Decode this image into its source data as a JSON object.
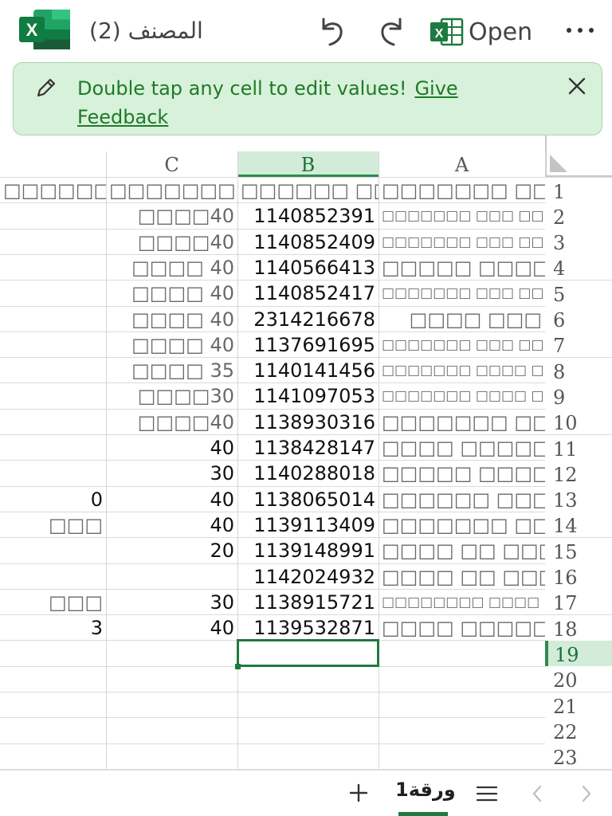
{
  "app": {
    "title": "المصنف (2)",
    "open_label": "Open",
    "logo_letter": "X"
  },
  "banner": {
    "message": "Double tap any cell to edit values!",
    "link": "Give Feedback"
  },
  "columns": [
    "C",
    "B",
    "A"
  ],
  "selected_column": "B",
  "rows": [
    {
      "n": "1",
      "a": "□□□□□□□ □□□",
      "b": "□□□□□□ □□□□□",
      "c": "□□□□□□□",
      "d": "□□□□□□□"
    },
    {
      "n": "2",
      "a": "□□□□□□□ □□□ □□ □□□□",
      "b": "1140852391",
      "c": "□□□□40",
      "d": ""
    },
    {
      "n": "3",
      "a": "□□□□□□□ □□□ □□ □□□□",
      "b": "1140852409",
      "c": "□□□□40",
      "d": ""
    },
    {
      "n": "4",
      "a": "□□□□□ □□□□□",
      "b": "1140566413",
      "c": "□□□□ 40",
      "d": ""
    },
    {
      "n": "5",
      "a": "□□□□□□□ □□□ □□ □□□□",
      "b": "1140852417",
      "c": "□□□□ 40",
      "d": ""
    },
    {
      "n": "6",
      "a": "□□□□ □□□",
      "b": "2314216678",
      "c": "□□□□ 40",
      "d": ""
    },
    {
      "n": "7",
      "a": "□□□□□□□ □□□ □□□□□",
      "b": "1137691695",
      "c": "□□□□ 40",
      "d": ""
    },
    {
      "n": "8",
      "a": "□□□□□□□ □□□□ □□□□□",
      "b": "1140141456",
      "c": "□□□□ 35",
      "d": ""
    },
    {
      "n": "9",
      "a": "□□□□□□□ □□□□ □□□□□",
      "b": "1141097053",
      "c": "□□□□30",
      "d": ""
    },
    {
      "n": "10",
      "a": "□□□□□□□ □□□□",
      "b": "1138930316",
      "c": "□□□□40",
      "d": ""
    },
    {
      "n": "11",
      "a": "□□□□ □□□□□",
      "b": "1138428147",
      "c": "40",
      "d": ""
    },
    {
      "n": "12",
      "a": "□□□□□ □□□□□",
      "b": "1140288018",
      "c": "30",
      "d": ""
    },
    {
      "n": "13",
      "a": "□□□□□□ □□□□□",
      "b": "1138065014",
      "c": "40",
      "d": "0"
    },
    {
      "n": "14",
      "a": "□□□□□□□ □□□□",
      "b": "1139113409",
      "c": "40",
      "d": "□□□"
    },
    {
      "n": "15",
      "a": "□□□□ □□ □□□□□",
      "b": "1139148991",
      "c": "20",
      "d": ""
    },
    {
      "n": "16",
      "a": "□□□□ □□ □□□□",
      "b": "1142024932",
      "c": "",
      "d": ""
    },
    {
      "n": "17",
      "a": "□□□□□□□□ □□□□ □□□□",
      "b": "1138915721",
      "c": "30",
      "d": "□□□"
    },
    {
      "n": "18",
      "a": "□□□□ □□□□□",
      "b": "1139532871",
      "c": "40",
      "d": "3"
    },
    {
      "n": "19",
      "a": "",
      "b": "",
      "c": "",
      "d": ""
    },
    {
      "n": "20",
      "a": "",
      "b": "",
      "c": "",
      "d": ""
    },
    {
      "n": "21",
      "a": "",
      "b": "",
      "c": "",
      "d": ""
    },
    {
      "n": "22",
      "a": "",
      "b": "",
      "c": "",
      "d": ""
    },
    {
      "n": "23",
      "a": "",
      "b": "",
      "c": "",
      "d": ""
    }
  ],
  "selected_row": "19",
  "sheet": {
    "name": "ورقة1"
  },
  "colors": {
    "excel_green": "#1e7a3f",
    "banner_bg": "#d8f1da",
    "banner_text": "#1f7a2a",
    "selection_bg": "#d3ecd9"
  },
  "icons": [
    "excel-logo-icon",
    "undo-icon",
    "redo-icon",
    "excel-open-icon",
    "more-icon",
    "pencil-icon",
    "close-icon",
    "select-all-icon",
    "plus-icon",
    "list-icon",
    "chevron-left-icon",
    "chevron-right-icon"
  ]
}
